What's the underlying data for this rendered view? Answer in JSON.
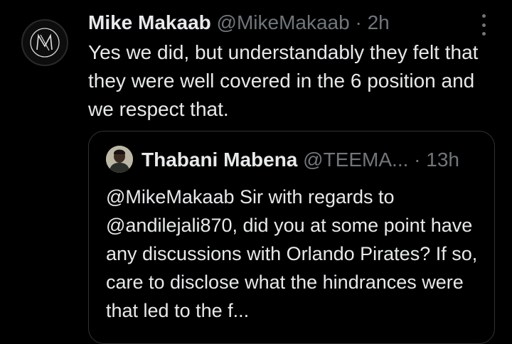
{
  "tweet": {
    "author_name": "Mike Makaab",
    "author_handle": "@MikeMakaab",
    "separator": "·",
    "time": "2h",
    "text": "Yes we did, but understandably they felt that they were well covered in the 6 position and we respect that.",
    "avatar_icon": "monogram-m-logo-icon",
    "more_icon": "more-options-icon"
  },
  "quoted_tweet": {
    "author_name": "Thabani Mabena",
    "author_handle": "@TEEMA...",
    "separator": "·",
    "time": "13h",
    "text": "@MikeMakaab Sir with regards to @andilejali870, did you at some point have any discussions with Orlando Pirates? If so, care to disclose what the hindrances were that led to the f..."
  },
  "colors": {
    "background": "#000000",
    "primary_text": "#e7e9ea",
    "secondary_text": "#71767b",
    "border": "#2f3336"
  }
}
